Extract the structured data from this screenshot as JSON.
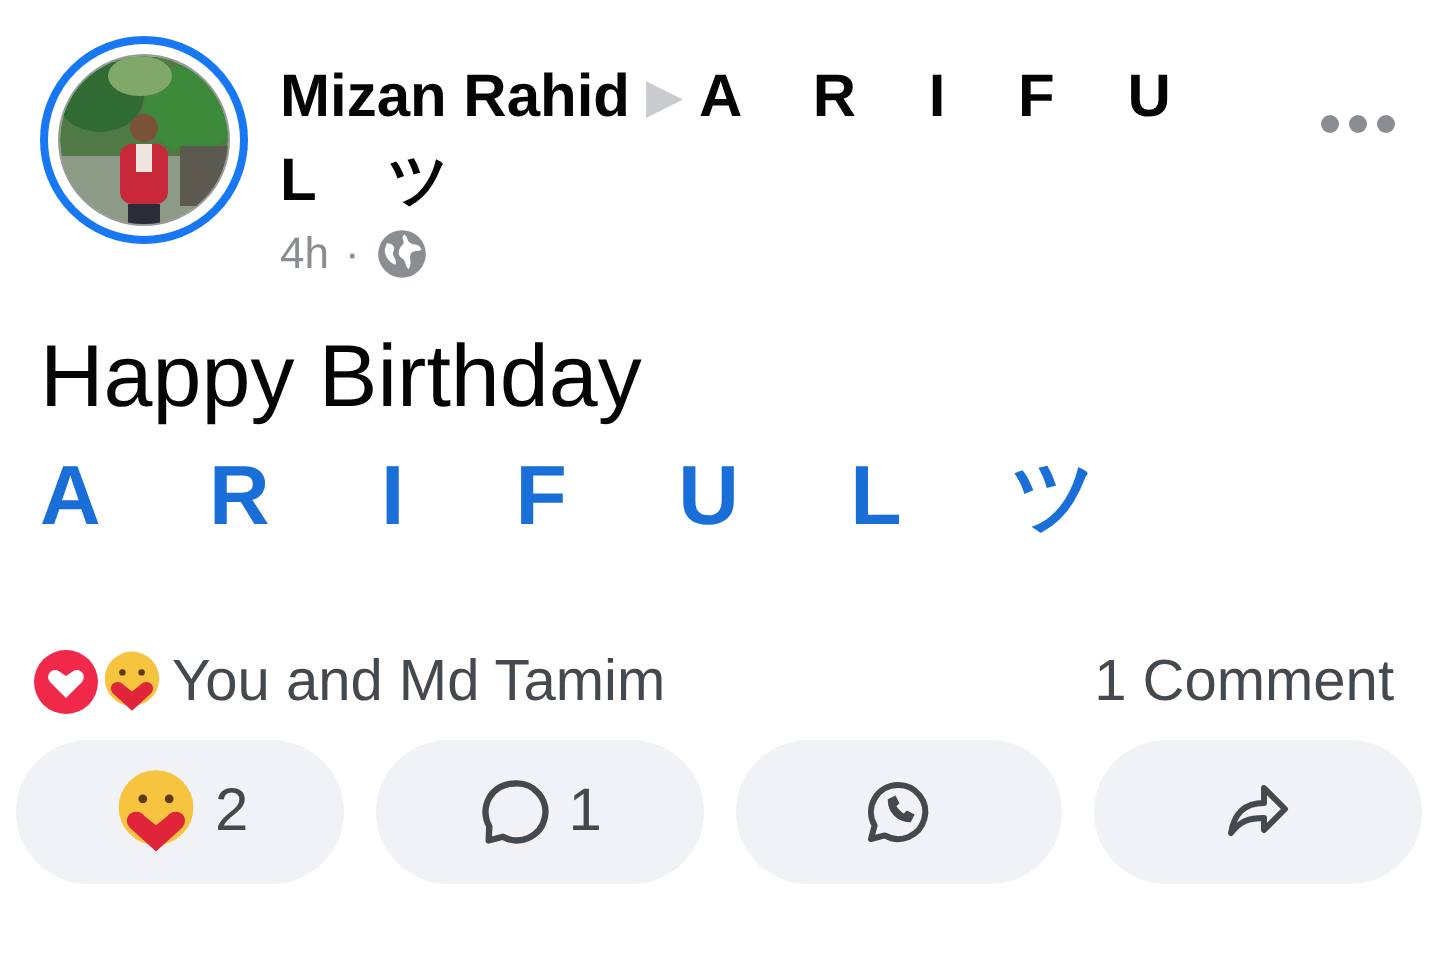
{
  "post": {
    "author": "Mizan Rahid",
    "pointer": "▶",
    "target": "A R I F U L ツ",
    "time": "4h",
    "separator": "·",
    "public": true
  },
  "message": {
    "line": "Happy Birthday",
    "tagged": "A R I F U L ツ"
  },
  "reactions": {
    "summary": "You and Md Tamim",
    "comments": "1 Comment"
  },
  "actions": [
    {
      "kind": "react",
      "count": "2"
    },
    {
      "kind": "comment",
      "count": "1"
    },
    {
      "kind": "whatsapp"
    },
    {
      "kind": "share"
    }
  ]
}
